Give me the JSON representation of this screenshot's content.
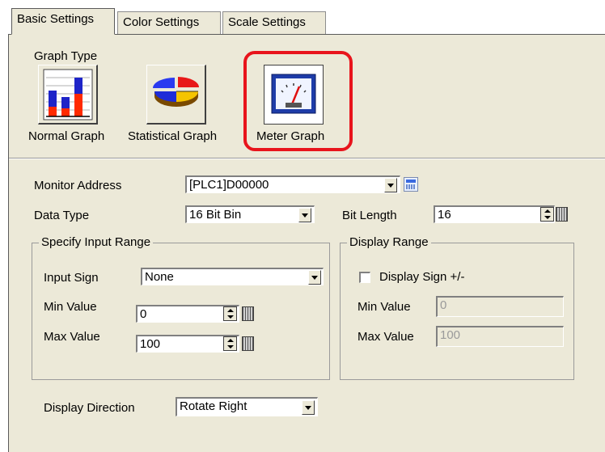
{
  "tabs": [
    {
      "label": "Basic Settings",
      "active": true
    },
    {
      "label": "Color Settings",
      "active": false
    },
    {
      "label": "Scale Settings",
      "active": false
    }
  ],
  "graph_type": {
    "title": "Graph Type",
    "options": [
      {
        "label": "Normal Graph",
        "icon": "bar-graph-icon"
      },
      {
        "label": "Statistical Graph",
        "icon": "pie-chart-icon"
      },
      {
        "label": "Meter Graph",
        "icon": "meter-gauge-icon",
        "selected": true
      }
    ],
    "highlight_color": "#e8141c"
  },
  "monitor_address": {
    "label": "Monitor Address",
    "value": "[PLC1]D00000"
  },
  "data_type": {
    "label": "Data Type",
    "value": "16 Bit Bin"
  },
  "bit_length": {
    "label": "Bit Length",
    "value": "16"
  },
  "input_range": {
    "title": "Specify Input Range",
    "input_sign_label": "Input Sign",
    "input_sign_value": "None",
    "min_label": "Min Value",
    "min_value": "0",
    "max_label": "Max Value",
    "max_value": "100"
  },
  "display_range": {
    "title": "Display Range",
    "display_sign_label": "Display Sign +/-",
    "display_sign_checked": false,
    "min_label": "Min Value",
    "min_value": "0",
    "max_label": "Max Value",
    "max_value": "100"
  },
  "display_direction": {
    "label": "Display Direction",
    "value": "Rotate Right"
  }
}
